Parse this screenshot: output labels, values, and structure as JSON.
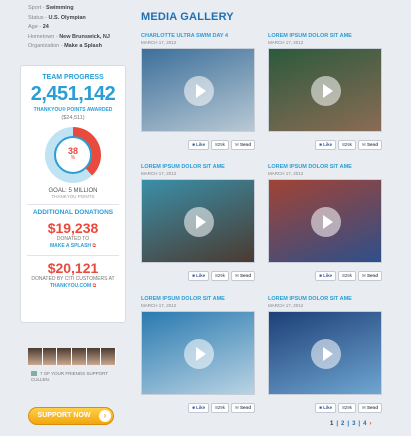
{
  "profile": {
    "rows": [
      {
        "label": "Sport - ",
        "value": "Swimming"
      },
      {
        "label": "Status - ",
        "value": "U.S. Olympian"
      },
      {
        "label": "Age - ",
        "value": "24"
      },
      {
        "label": "Hometown - ",
        "value": "New Brunswick, NJ"
      },
      {
        "label": "Organization - ",
        "value": "Make a Splash"
      }
    ]
  },
  "team": {
    "heading": "TEAM PROGRESS",
    "points": "2,451,142",
    "points_label": "THANKYOU® POINTS AWARDED",
    "points_dollars": "($24,511)",
    "percent": "38",
    "percent_sign": "%",
    "goal": "GOAL: 5 MILLION",
    "goal_sub": "THANKYOU POINTS",
    "additional_heading": "ADDITIONAL DONATIONS",
    "donation1_amount": "$19,238",
    "donation1_label": "DONATED TO",
    "donation1_link": "MAKE A SPLASH",
    "donation2_amount": "$20,121",
    "donation2_label": "DONATED BY CITI CUSTOMERS AT",
    "donation2_link": "THANKYOU.COM"
  },
  "invite": {
    "text": "7 OF YOUR FRIENDS SUPPORT CULLEN."
  },
  "support_button": {
    "label": "SUPPORT NOW"
  },
  "gallery": {
    "title": "MEDIA GALLERY",
    "cards": [
      {
        "title": "CHARLOTTE ULTRA SWIM DAY 4",
        "date": "MARCH 17, 2012",
        "likes": "829k",
        "like_label": "Like",
        "send_label": "Send",
        "colors": [
          "#3d6f9a",
          "#b8c9d4"
        ]
      },
      {
        "title": "LOREM IPSUM DOLOR SIT AME",
        "date": "MARCH 17, 2012",
        "likes": "829k",
        "like_label": "Like",
        "send_label": "Send",
        "colors": [
          "#2c5a3c",
          "#8a6b55"
        ]
      },
      {
        "title": "LOREM IPSUM DOLOR SIT AME",
        "date": "MARCH 17, 2012",
        "likes": "829k",
        "like_label": "Like",
        "send_label": "Send",
        "colors": [
          "#3a8fa8",
          "#4b3a30"
        ]
      },
      {
        "title": "LOREM IPSUM DOLOR SIT AME",
        "date": "MARCH 17, 2012",
        "likes": "829k",
        "like_label": "Like",
        "send_label": "Send",
        "colors": [
          "#a14334",
          "#2e4f8a"
        ]
      },
      {
        "title": "LOREM IPSUM DOLOR SIT AME",
        "date": "MARCH 17, 2012",
        "likes": "829k",
        "like_label": "Like",
        "send_label": "Send",
        "colors": [
          "#2a7ab0",
          "#b9d3e3"
        ]
      },
      {
        "title": "LOREM IPSUM DOLOR SIT AME",
        "date": "MARCH 17, 2012",
        "likes": "829k",
        "like_label": "Like",
        "send_label": "Send",
        "colors": [
          "#1d3f78",
          "#6fa6d1"
        ]
      }
    ]
  },
  "pager": {
    "pages": [
      "1",
      "2",
      "3",
      "4"
    ],
    "current": "1",
    "next": "›"
  },
  "colors": {
    "accent": "#2a9fd6",
    "red": "#e84a3d",
    "orange": "#f2a60c"
  }
}
